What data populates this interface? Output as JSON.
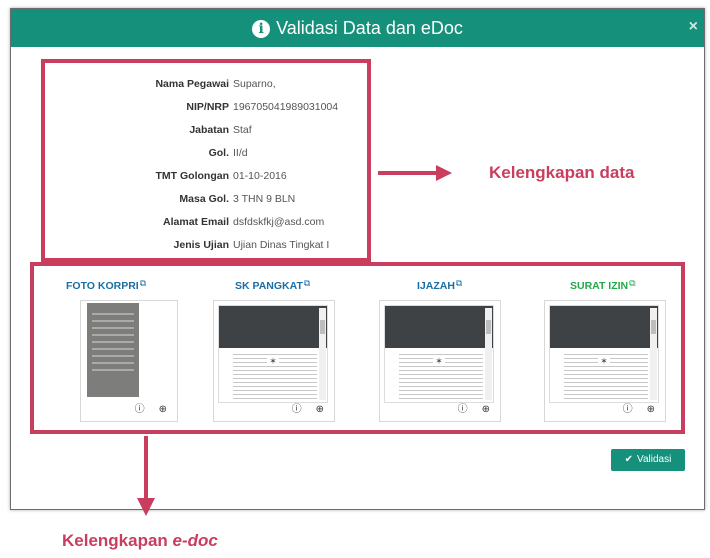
{
  "modal": {
    "title": "Validasi Data dan eDoc",
    "close_label": "×"
  },
  "employee": [
    {
      "label": "Nama Pegawai",
      "value": "Suparno,"
    },
    {
      "label": "NIP/NRP",
      "value": "196705041989031004"
    },
    {
      "label": "Jabatan",
      "value": "Staf"
    },
    {
      "label": "Gol.",
      "value": "II/d"
    },
    {
      "label": "TMT Golongan",
      "value": "01-10-2016"
    },
    {
      "label": "Masa Gol.",
      "value": "3 THN 9 BLN"
    },
    {
      "label": "Alamat Email",
      "value": "dsfdskfkj@asd.com"
    },
    {
      "label": "Jenis Ujian",
      "value": "Ujian Dinas Tingkat I"
    }
  ],
  "documents": [
    {
      "title": "FOTO KORPRI",
      "color": "#1a6ea4"
    },
    {
      "title": "SK PANGKAT",
      "color": "#1a6ea4"
    },
    {
      "title": "IJAZAH",
      "color": "#1a6ea4"
    },
    {
      "title": "SURAT IZIN",
      "color": "#21a94a"
    }
  ],
  "icons": {
    "info": "info-icon",
    "external_link": "external-link-icon",
    "info_circle": "info-circle-icon",
    "zoom": "zoom-in-icon",
    "check": "check-icon"
  },
  "validasi_label": "Validasi",
  "annotations": {
    "kelengkapan_data": "Kelengkapan data",
    "kelengkapan_edoc_prefix": "Kelengkapan",
    "kelengkapan_edoc_em": "e-doc"
  },
  "colors": {
    "header": "#15907a",
    "annotation": "#c93e5e"
  }
}
